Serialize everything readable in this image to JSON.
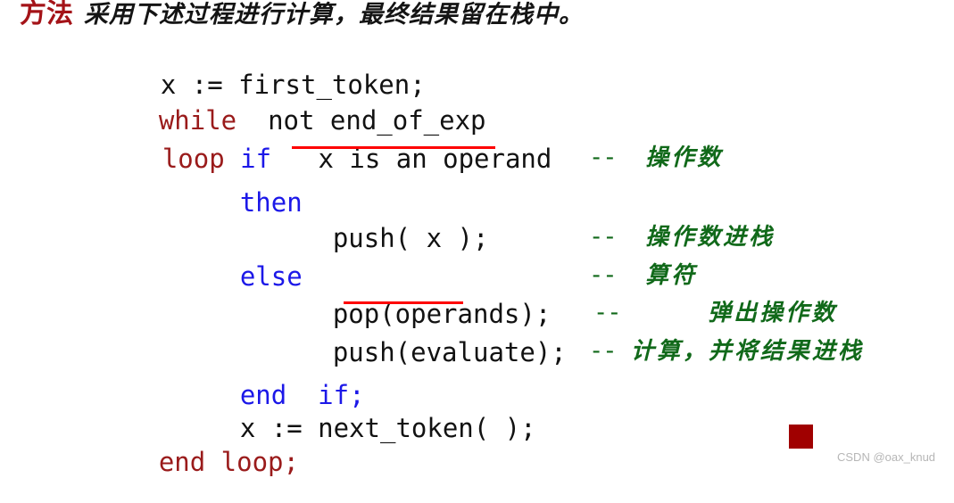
{
  "slide": {
    "background_color": "#ffffff",
    "title": {
      "keyword": "方法",
      "keyword_color": "#a41318",
      "body": "采用下述过程进行计算，最终结果留在栈中。",
      "body_color": "#141414"
    },
    "palette": {
      "keyword_red": "#9a1b1b",
      "keyword_blue": "#1c18e8",
      "code_black": "#121212",
      "comment_green": "#11691a",
      "underline_red": "#fe0000",
      "square_red": "#a00000",
      "watermark_gray": "#b6b6b6"
    },
    "code_lines": [
      {
        "id": "line-1",
        "text": "x := first_token;"
      },
      {
        "id": "line-2",
        "keyword": "while",
        "rest": "  not end_of_exp"
      },
      {
        "id": "line-3",
        "keyword": "loop",
        "keyword2": "if",
        "rest": "   x is an operand"
      },
      {
        "id": "line-4",
        "keyword": "then"
      },
      {
        "id": "line-5",
        "text": "push( x );"
      },
      {
        "id": "line-6",
        "keyword": "else"
      },
      {
        "id": "line-7",
        "text": "pop(operands);"
      },
      {
        "id": "line-8",
        "text": "push(evaluate);"
      },
      {
        "id": "line-9",
        "keyword": "end",
        "keyword2": "if;"
      },
      {
        "id": "line-10",
        "text": "x := next_token( );"
      },
      {
        "id": "line-11",
        "keyword": "end loop;"
      }
    ],
    "comments": [
      {
        "id": "comment-operand",
        "dash": "--",
        "text": "操作数"
      },
      {
        "id": "comment-push-operand",
        "dash": "--",
        "text": "操作数进栈"
      },
      {
        "id": "comment-operator",
        "dash": "--",
        "text": "算符"
      },
      {
        "id": "comment-pop-operand",
        "dash": "--",
        "text": "弹出操作数"
      },
      {
        "id": "comment-evaluate",
        "dash": "--",
        "text": "计算，并将结果进栈"
      }
    ],
    "watermark": "CSDN @oax_knud"
  }
}
